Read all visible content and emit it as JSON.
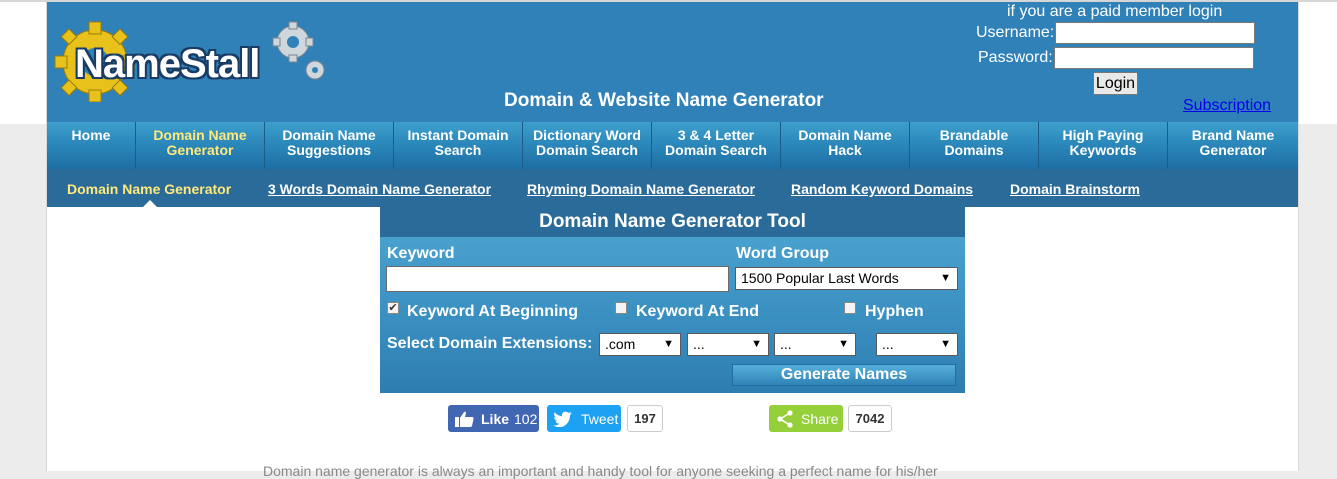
{
  "header": {
    "logo_text": "NameStall",
    "site_title": "Domain & Website Name Generator",
    "login_note": "if you are a paid member login",
    "username_label": "Username:",
    "password_label": "Password:",
    "login_button": "Login",
    "subscription_link": "Subscription"
  },
  "nav": {
    "items": [
      {
        "line1": "Home",
        "line2": ""
      },
      {
        "line1": "Domain Name",
        "line2": "Generator"
      },
      {
        "line1": "Domain Name",
        "line2": "Suggestions"
      },
      {
        "line1": "Instant Domain",
        "line2": "Search"
      },
      {
        "line1": "Dictionary Word",
        "line2": "Domain Search"
      },
      {
        "line1": "3 & 4 Letter",
        "line2": "Domain Search"
      },
      {
        "line1": "Domain Name",
        "line2": "Hack"
      },
      {
        "line1": "Brandable",
        "line2": "Domains"
      },
      {
        "line1": "High Paying",
        "line2": "Keywords"
      },
      {
        "line1": "Brand Name",
        "line2": "Generator"
      }
    ],
    "active_index": 1
  },
  "subnav": {
    "items": [
      "Domain Name Generator",
      "3 Words Domain Name Generator",
      "Rhyming Domain Name Generator",
      "Random Keyword Domains",
      "Domain Brainstorm"
    ]
  },
  "tool": {
    "title": "Domain Name Generator Tool",
    "keyword_label": "Keyword",
    "keyword_value": "",
    "word_group_label": "Word Group",
    "word_group_selected": "1500 Popular Last Words",
    "opt_beginning": "Keyword At Beginning",
    "opt_end": "Keyword At End",
    "opt_hyphen": "Hyphen",
    "ext_label": "Select Domain Extensions:",
    "ext1": ".com",
    "ext2": "...",
    "ext3": "...",
    "ext4": "...",
    "generate_button": "Generate Names"
  },
  "social": {
    "fb_label": "Like",
    "fb_count": "102",
    "tw_label": "Tweet",
    "tw_count": "197",
    "share_label": "Share",
    "share_count": "7042"
  },
  "description": "Domain name generator is always an important and handy tool for anyone seeking a perfect name for his/her"
}
